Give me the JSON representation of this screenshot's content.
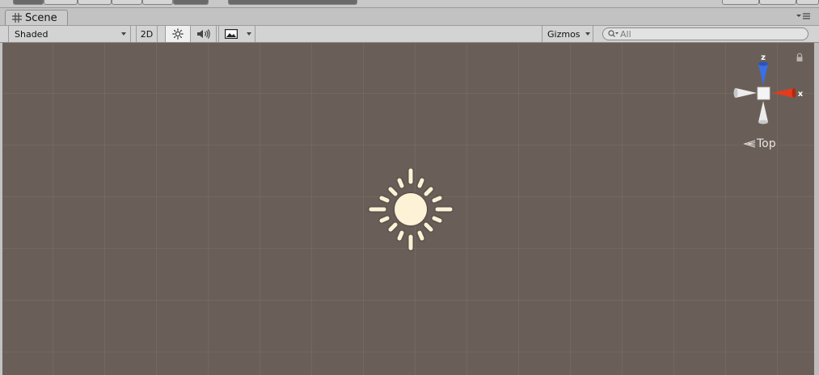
{
  "tab": {
    "title": "Scene",
    "menu_icon": "tab-menu-icon"
  },
  "toolbar": {
    "shading_mode": "Shaded",
    "mode_2d_label": "2D",
    "lighting_icon": "sun-icon",
    "audio_icon": "speaker-icon",
    "effects_icon": "image-icon",
    "gizmos_label": "Gizmos",
    "search_placeholder": "All"
  },
  "viewport": {
    "background_color": "#6a5f58",
    "light_icon": "directional-light-icon",
    "orientation": {
      "axis_z": "z",
      "axis_x": "x",
      "view_label": "Top",
      "colors": {
        "z": "#3a6fe6",
        "x": "#e23b1e",
        "neutral": "#ececec"
      }
    }
  }
}
